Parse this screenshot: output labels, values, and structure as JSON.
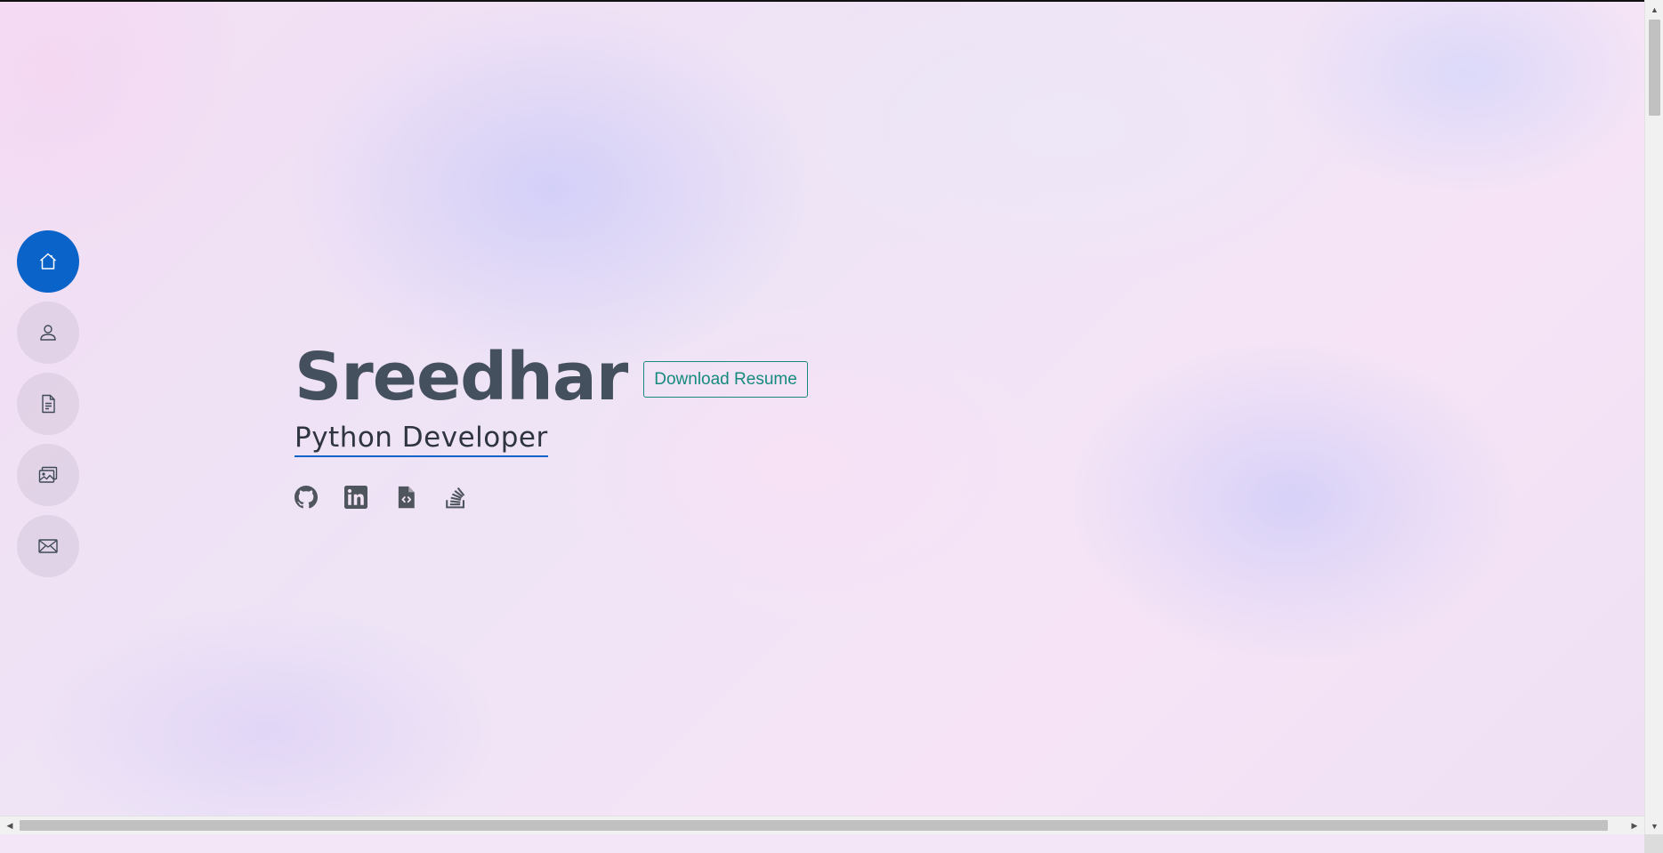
{
  "nav": {
    "items": [
      {
        "icon": "home-icon",
        "active": true
      },
      {
        "icon": "person-icon",
        "active": false
      },
      {
        "icon": "document-icon",
        "active": false
      },
      {
        "icon": "images-icon",
        "active": false
      },
      {
        "icon": "envelope-icon",
        "active": false
      }
    ],
    "active_color": "#0a63c9"
  },
  "hero": {
    "name": "Sreedhar",
    "resume_button": "Download Resume",
    "role": "Python Developer"
  },
  "social": [
    {
      "icon": "github-icon"
    },
    {
      "icon": "linkedin-icon"
    },
    {
      "icon": "code-file-icon"
    },
    {
      "icon": "stackoverflow-icon"
    }
  ],
  "colors": {
    "name_text": "#45505e",
    "resume_button": "#158a7d",
    "role_underline": "#0a63c9",
    "social_icons": "#4f555d"
  }
}
